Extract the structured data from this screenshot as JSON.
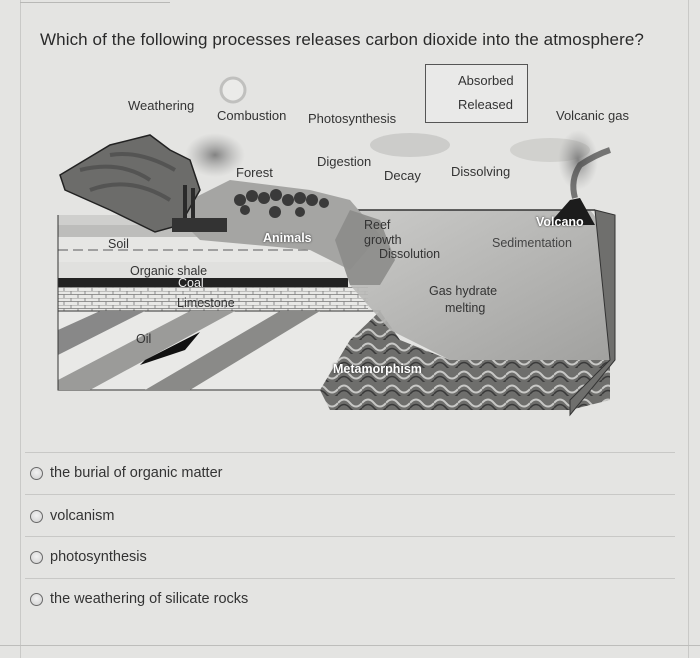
{
  "question": {
    "text": "Which of the following processes releases carbon dioxide into the atmosphere?"
  },
  "diagram": {
    "legend": {
      "absorbed": "Absorbed",
      "released": "Released"
    },
    "labels": {
      "weathering": "Weathering",
      "combustion": "Combustion",
      "photosynthesis": "Photosynthesis",
      "volcanic_gas": "Volcanic gas",
      "forest": "Forest",
      "digestion": "Digestion",
      "decay": "Decay",
      "dissolving": "Dissolving",
      "animals": "Animals",
      "soil": "Soil",
      "reef_growth_1": "Reef",
      "reef_growth_2": "growth",
      "dissolution": "Dissolution",
      "volcano": "Volcano",
      "sedimentation": "Sedimentation",
      "organic_shale": "Organic shale",
      "coal": "Coal",
      "limestone": "Limestone",
      "gas_hydrate_1": "Gas hydrate",
      "gas_hydrate_2": "melting",
      "oil": "Oil",
      "metamorphism": "Metamorphism"
    }
  },
  "options": [
    {
      "label": "the burial of organic matter",
      "selected": false
    },
    {
      "label": "volcanism",
      "selected": false
    },
    {
      "label": "photosynthesis",
      "selected": false
    },
    {
      "label": "the weathering of silicate rocks",
      "selected": false
    }
  ]
}
